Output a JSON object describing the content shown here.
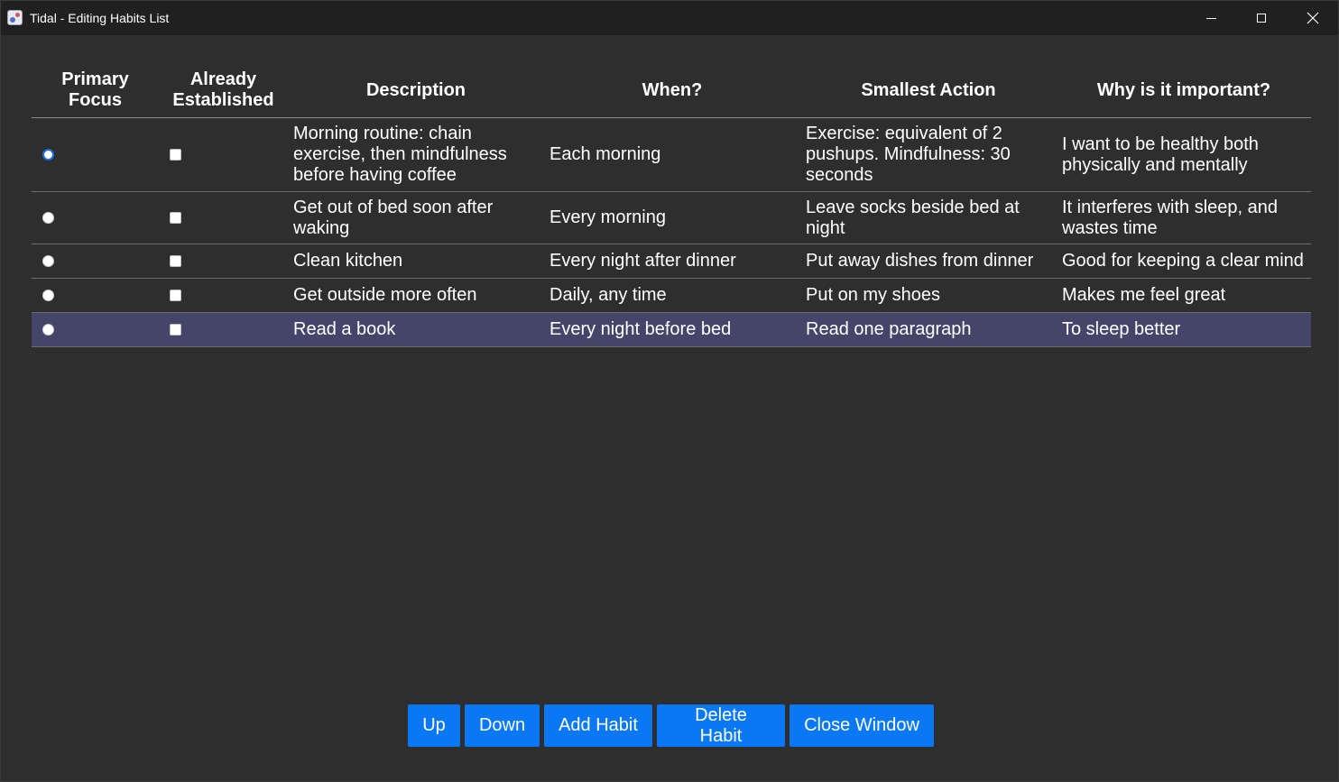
{
  "window": {
    "title": "Tidal - Editing Habits List"
  },
  "table": {
    "headers": {
      "primary_focus": "Primary Focus",
      "already_established": "Already Established",
      "description": "Description",
      "when": "When?",
      "smallest_action": "Smallest Action",
      "why": "Why is it important?"
    },
    "rows": [
      {
        "primary_focus": true,
        "already_established": false,
        "description": "Morning routine: chain exercise, then mindfulness before having coffee",
        "when": "Each morning",
        "smallest_action": "Exercise: equivalent of 2 pushups. Mindfulness: 30 seconds",
        "why": "I want to be healthy both physically and mentally",
        "selected": false
      },
      {
        "primary_focus": false,
        "already_established": false,
        "description": "Get out of bed soon after waking",
        "when": "Every morning",
        "smallest_action": "Leave socks beside bed at night",
        "why": "It interferes with sleep, and wastes time",
        "selected": false
      },
      {
        "primary_focus": false,
        "already_established": false,
        "description": "Clean kitchen",
        "when": "Every night after dinner",
        "smallest_action": "Put away dishes from dinner",
        "why": "Good for keeping a clear mind",
        "selected": false
      },
      {
        "primary_focus": false,
        "already_established": false,
        "description": "Get outside more often",
        "when": "Daily, any time",
        "smallest_action": "Put on my shoes",
        "why": "Makes me feel great",
        "selected": false
      },
      {
        "primary_focus": false,
        "already_established": false,
        "description": "Read a book",
        "when": "Every night before bed",
        "smallest_action": "Read one paragraph",
        "why": "To sleep better",
        "selected": true
      }
    ]
  },
  "buttons": {
    "up": "Up",
    "down": "Down",
    "add_habit": "Add Habit",
    "delete_habit": "Delete Habit",
    "close_window": "Close Window"
  },
  "colors": {
    "background": "#2e2e2e",
    "titlebar": "#202020",
    "selected_row": "#45456a",
    "button": "#0a78f5",
    "radio_checked": "#1a6ee8"
  }
}
